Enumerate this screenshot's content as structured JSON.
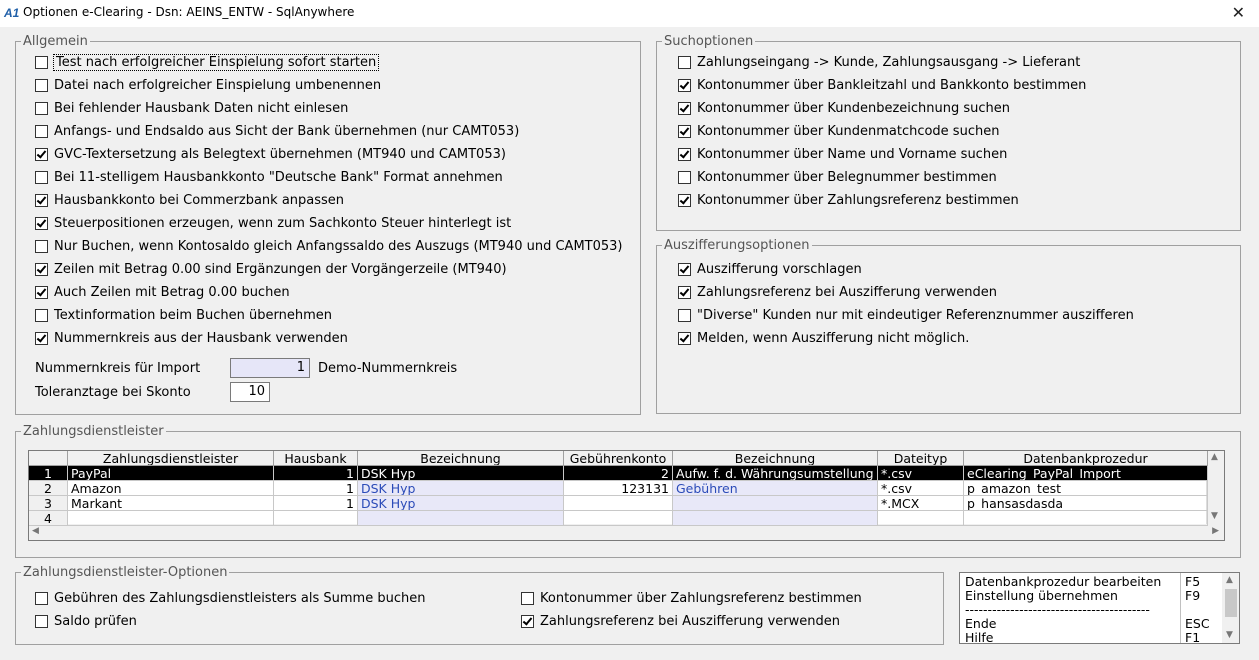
{
  "window": {
    "title": "Optionen e-Clearing - Dsn: AEINS_ENTW - SqlAnywhere",
    "close_glyph": "✕",
    "app_icon_text": "A1"
  },
  "allgemein": {
    "legend": "Allgemein",
    "options": [
      {
        "label": "Test nach erfolgreicher Einspielung sofort starten",
        "checked": false
      },
      {
        "label": "Datei nach erfolgreicher Einspielung umbenennen",
        "checked": false
      },
      {
        "label": "Bei fehlender Hausbank Daten nicht einlesen",
        "checked": false
      },
      {
        "label": "Anfangs- und Endsaldo aus Sicht der Bank übernehmen (nur CAMT053)",
        "checked": false
      },
      {
        "label": "GVC-Textersetzung als Belegtext übernehmen (MT940 und CAMT053)",
        "checked": true
      },
      {
        "label": "Bei 11-stelligem Hausbankkonto \"Deutsche Bank\" Format annehmen",
        "checked": false
      },
      {
        "label": "Hausbankkonto bei Commerzbank anpassen",
        "checked": true
      },
      {
        "label": "Steuerpositionen erzeugen, wenn zum Sachkonto Steuer hinterlegt ist",
        "checked": true
      },
      {
        "label": "Nur Buchen, wenn Kontosaldo gleich Anfangssaldo des Auszugs (MT940 und CAMT053)",
        "checked": false
      },
      {
        "label": "Zeilen mit Betrag 0.00 sind Ergänzungen der Vorgängerzeile (MT940)",
        "checked": true
      },
      {
        "label": "Auch Zeilen mit Betrag 0.00 buchen",
        "checked": true
      },
      {
        "label": "Textinformation beim Buchen übernehmen",
        "checked": false
      },
      {
        "label": "Nummernkreis aus der Hausbank verwenden",
        "checked": true
      }
    ],
    "nummernkreis_label": "Nummernkreis für Import",
    "nummernkreis_value": "1",
    "nummernkreis_name": "Demo-Nummernkreis",
    "toleranz_label": "Toleranztage bei Skonto",
    "toleranz_value": "10"
  },
  "suchoptionen": {
    "legend": "Suchoptionen",
    "options": [
      {
        "label": "Zahlungseingang -> Kunde, Zahlungsausgang -> Lieferant",
        "checked": false
      },
      {
        "label": "Kontonummer über Bankleitzahl und Bankkonto bestimmen",
        "checked": true
      },
      {
        "label": "Kontonummer über Kundenbezeichnung suchen",
        "checked": true
      },
      {
        "label": "Kontonummer über Kundenmatchcode suchen",
        "checked": true
      },
      {
        "label": "Kontonummer über Name und Vorname suchen",
        "checked": true
      },
      {
        "label": "Kontonummer über Belegnummer bestimmen",
        "checked": false
      },
      {
        "label": "Kontonummer über Zahlungsreferenz bestimmen",
        "checked": true
      }
    ]
  },
  "auszifferung": {
    "legend": "Auszifferungsoptionen",
    "options": [
      {
        "label": "Auszifferung vorschlagen",
        "checked": true
      },
      {
        "label": "Zahlungsreferenz bei Auszifferung verwenden",
        "checked": true
      },
      {
        "label": "\"Diverse\" Kunden nur mit eindeutiger Referenznummer auszifferen",
        "checked": false
      },
      {
        "label": "Melden, wenn Auszifferung nicht möglich.",
        "checked": true
      }
    ]
  },
  "zahlungsdienstleister": {
    "legend": "Zahlungsdienstleister",
    "columns": [
      "Zahlungsdienstleister",
      "Hausbank",
      "Bezeichnung",
      "Gebührenkonto",
      "Bezeichnung",
      "Dateityp",
      "Datenbankprozedur"
    ],
    "rows": [
      {
        "nr": "1",
        "cells": [
          "PayPal",
          "1",
          "DSK Hyp",
          "2",
          "Aufw. f. d. Währungsumstellung",
          "*.csv",
          "eClearing_PayPal_Import"
        ]
      },
      {
        "nr": "2",
        "cells": [
          "Amazon",
          "1",
          "DSK Hyp",
          "123131",
          "Gebühren",
          "*.csv",
          "p_amazon_test"
        ]
      },
      {
        "nr": "3",
        "cells": [
          "Markant",
          "1",
          "DSK Hyp",
          "",
          "",
          "*.MCX",
          "p_hansasdasda"
        ]
      },
      {
        "nr": "4",
        "cells": [
          "",
          "",
          "",
          "",
          "",
          "",
          ""
        ]
      }
    ]
  },
  "zd_optionen": {
    "legend": "Zahlungsdienstleister-Optionen",
    "options": [
      {
        "label": "Gebühren des Zahlungsdienstleisters als Summe buchen",
        "checked": false
      },
      {
        "label": "Saldo prüfen",
        "checked": false
      },
      {
        "label": "Kontonummer über Zahlungsreferenz bestimmen",
        "checked": false
      },
      {
        "label": "Zahlungsreferenz bei Auszifferung verwenden",
        "checked": true
      }
    ]
  },
  "actions": [
    {
      "label": "Datenbankprozedur bearbeiten",
      "key": "F5"
    },
    {
      "label": "Einstellung übernehmen",
      "key": "F9"
    },
    {
      "label": "-----------------------------------------",
      "key": ""
    },
    {
      "label": "Ende",
      "key": "ESC"
    },
    {
      "label": "Hilfe",
      "key": "F1"
    }
  ]
}
